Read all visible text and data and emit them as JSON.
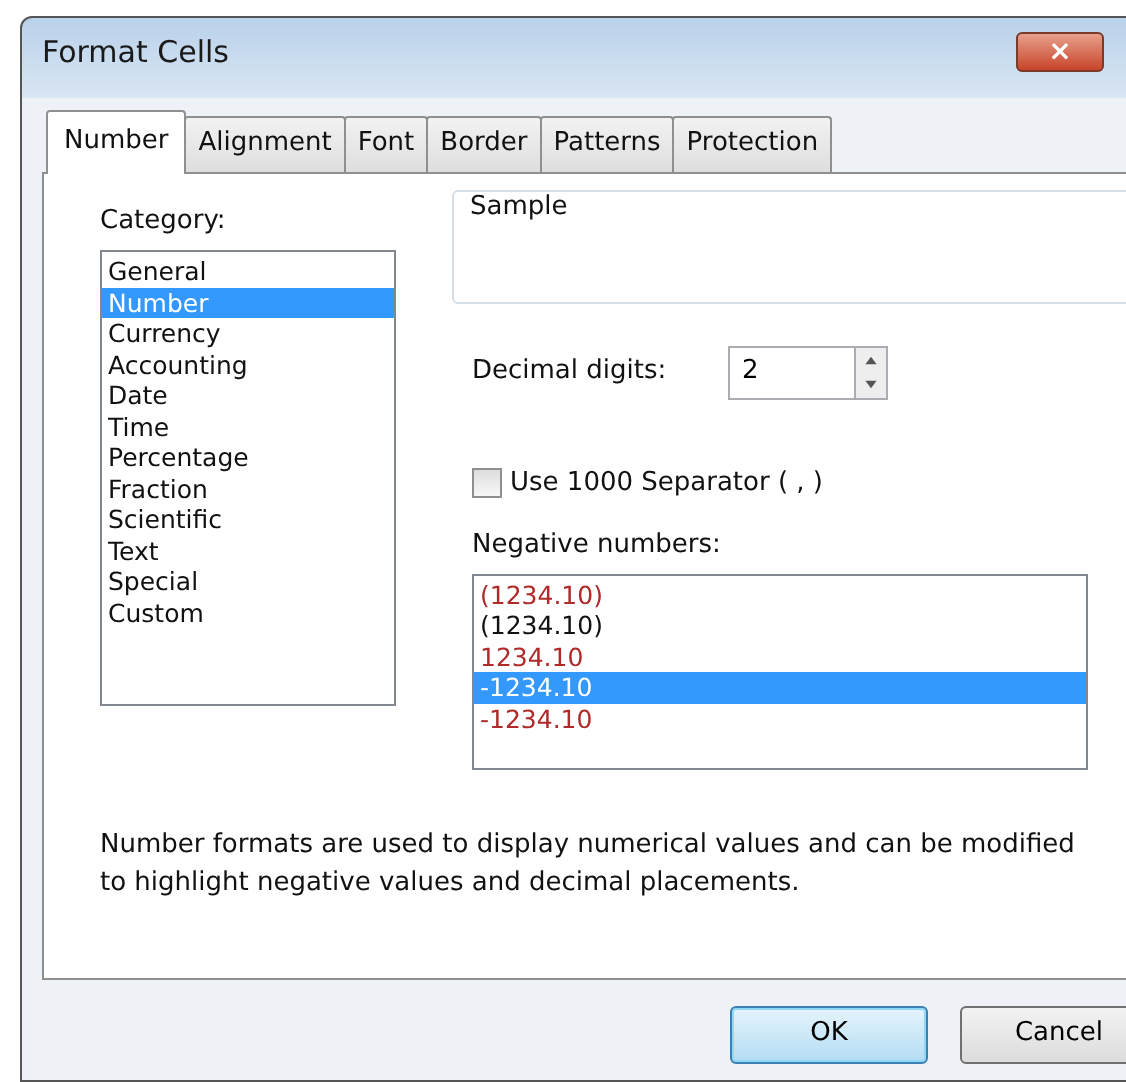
{
  "window": {
    "title": "Format Cells",
    "close": "×"
  },
  "tabs": [
    {
      "label": "Number",
      "selected": true
    },
    {
      "label": "Alignment",
      "selected": false
    },
    {
      "label": "Font",
      "selected": false
    },
    {
      "label": "Border",
      "selected": false
    },
    {
      "label": "Patterns",
      "selected": false
    },
    {
      "label": "Protection",
      "selected": false
    }
  ],
  "category": {
    "label": "Category:",
    "items": [
      {
        "label": "General",
        "selected": false
      },
      {
        "label": "Number",
        "selected": true
      },
      {
        "label": "Currency",
        "selected": false
      },
      {
        "label": "Accounting",
        "selected": false
      },
      {
        "label": "Date",
        "selected": false
      },
      {
        "label": "Time",
        "selected": false
      },
      {
        "label": "Percentage",
        "selected": false
      },
      {
        "label": "Fraction",
        "selected": false
      },
      {
        "label": "Scientific",
        "selected": false
      },
      {
        "label": "Text",
        "selected": false
      },
      {
        "label": "Special",
        "selected": false
      },
      {
        "label": "Custom",
        "selected": false
      }
    ]
  },
  "sample": {
    "label": "Sample"
  },
  "decimal_digits": {
    "label": "Decimal digits:",
    "value": "2"
  },
  "separator": {
    "label": "Use 1000 Separator ( , )",
    "checked": false
  },
  "negative_numbers": {
    "label": "Negative numbers:",
    "items": [
      {
        "label": "(1234.10)",
        "color": "#b02a2a",
        "selected": false
      },
      {
        "label": "(1234.10)",
        "color": "#111111",
        "selected": false
      },
      {
        "label": "1234.10",
        "color": "#b02a2a",
        "selected": false
      },
      {
        "label": "-1234.10",
        "selected": true
      },
      {
        "label": "-1234.10",
        "color": "#b02a2a",
        "selected": false
      }
    ]
  },
  "description": "Number formats are used to display numerical values and can be modified to highlight negative values and decimal placements.",
  "buttons": [
    {
      "label": "OK",
      "default": true
    },
    {
      "label": "Cancel",
      "default": false
    }
  ]
}
